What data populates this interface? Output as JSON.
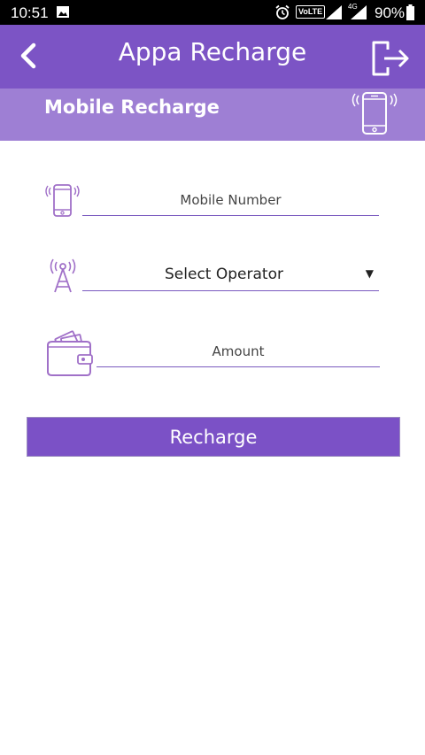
{
  "status_bar": {
    "time": "10:51",
    "volte": "VoLTE",
    "network": "4G",
    "battery": "90%"
  },
  "app_bar": {
    "title": "Appa Recharge"
  },
  "section": {
    "title": "Mobile Recharge"
  },
  "form": {
    "mobile_placeholder": "Mobile Number",
    "operator_selected": "Select Operator",
    "amount_placeholder": "Amount",
    "submit_label": "Recharge"
  },
  "colors": {
    "primary": "#7c54c5",
    "secondary": "#9e7fd4",
    "icon": "#a070c8"
  },
  "icons": [
    "back-icon",
    "logout-icon",
    "phone-signal-icon",
    "tower-icon",
    "wallet-icon"
  ]
}
